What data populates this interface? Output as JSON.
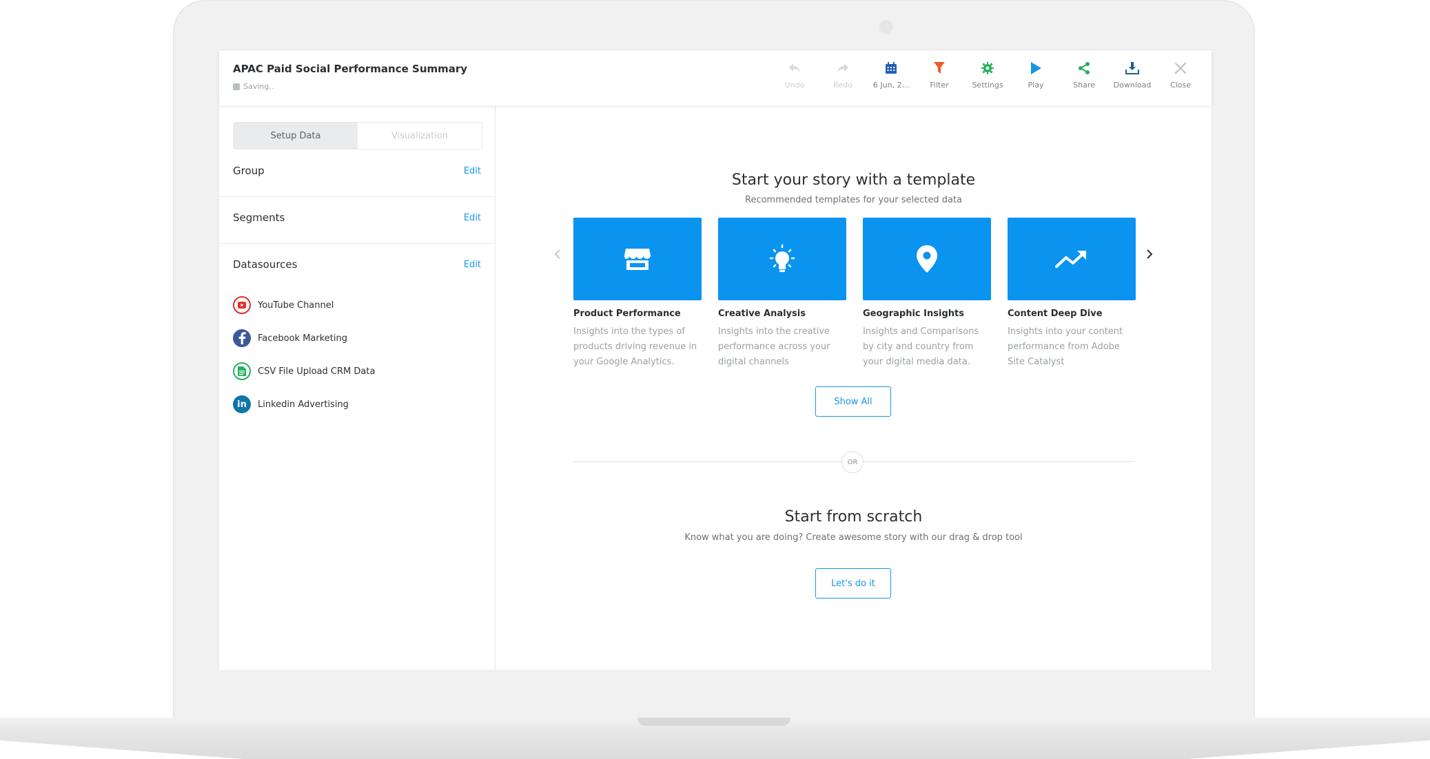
{
  "app": {
    "title": "APAC Paid Social Performance Summary",
    "status": "Saving.."
  },
  "toolbar": {
    "undo": "Undo",
    "redo": "Redo",
    "date": "6 Jun, 2...",
    "filter": "Filter",
    "settings": "Settings",
    "play": "Play",
    "share": "Share",
    "download": "Download",
    "close": "Close"
  },
  "colors": {
    "accent": "#1696e8",
    "card": "#0a94f0",
    "filter": "#f05a28",
    "settings": "#27ae60",
    "share": "#27ae60",
    "download": "#1f5f8b"
  },
  "sidebar": {
    "tabs": {
      "setup": "Setup Data",
      "visualization": "Visualization"
    },
    "group": "Group",
    "segments": "Segments",
    "datasources": "Datasources",
    "edit": "Edit",
    "sources": [
      {
        "label": "YouTube Channel",
        "icon": "youtube-icon"
      },
      {
        "label": "Facebook Marketing",
        "icon": "facebook-icon"
      },
      {
        "label": "CSV File Upload CRM Data",
        "icon": "csv-file-icon"
      },
      {
        "label": "Linkedin Advertising",
        "icon": "linkedin-icon"
      }
    ]
  },
  "main": {
    "heading": "Start your story with a template",
    "subheading": "Recommended templates for your selected data",
    "templates": [
      {
        "title": "Product Performance",
        "description": "Insights into the types of products driving revenue in your Google Analytics.",
        "icon": "store-icon"
      },
      {
        "title": "Creative Analysis",
        "description": "Insights into the creative performance across your digital channels",
        "icon": "lightbulb-icon"
      },
      {
        "title": "Geographic Insights",
        "description": "Insights and Comparisons by city and country from your digital media data.",
        "icon": "map-pin-icon"
      },
      {
        "title": "Content Deep Dive",
        "description": "Insights into your content performance from Adobe Site Catalyst",
        "icon": "trending-up-icon"
      }
    ],
    "show_all": "Show All",
    "or": "OR",
    "scratch_heading": "Start from scratch",
    "scratch_subheading": "Know what you are doing? Create awesome story with our drag & drop tool",
    "scratch_button": "Let's do it"
  }
}
